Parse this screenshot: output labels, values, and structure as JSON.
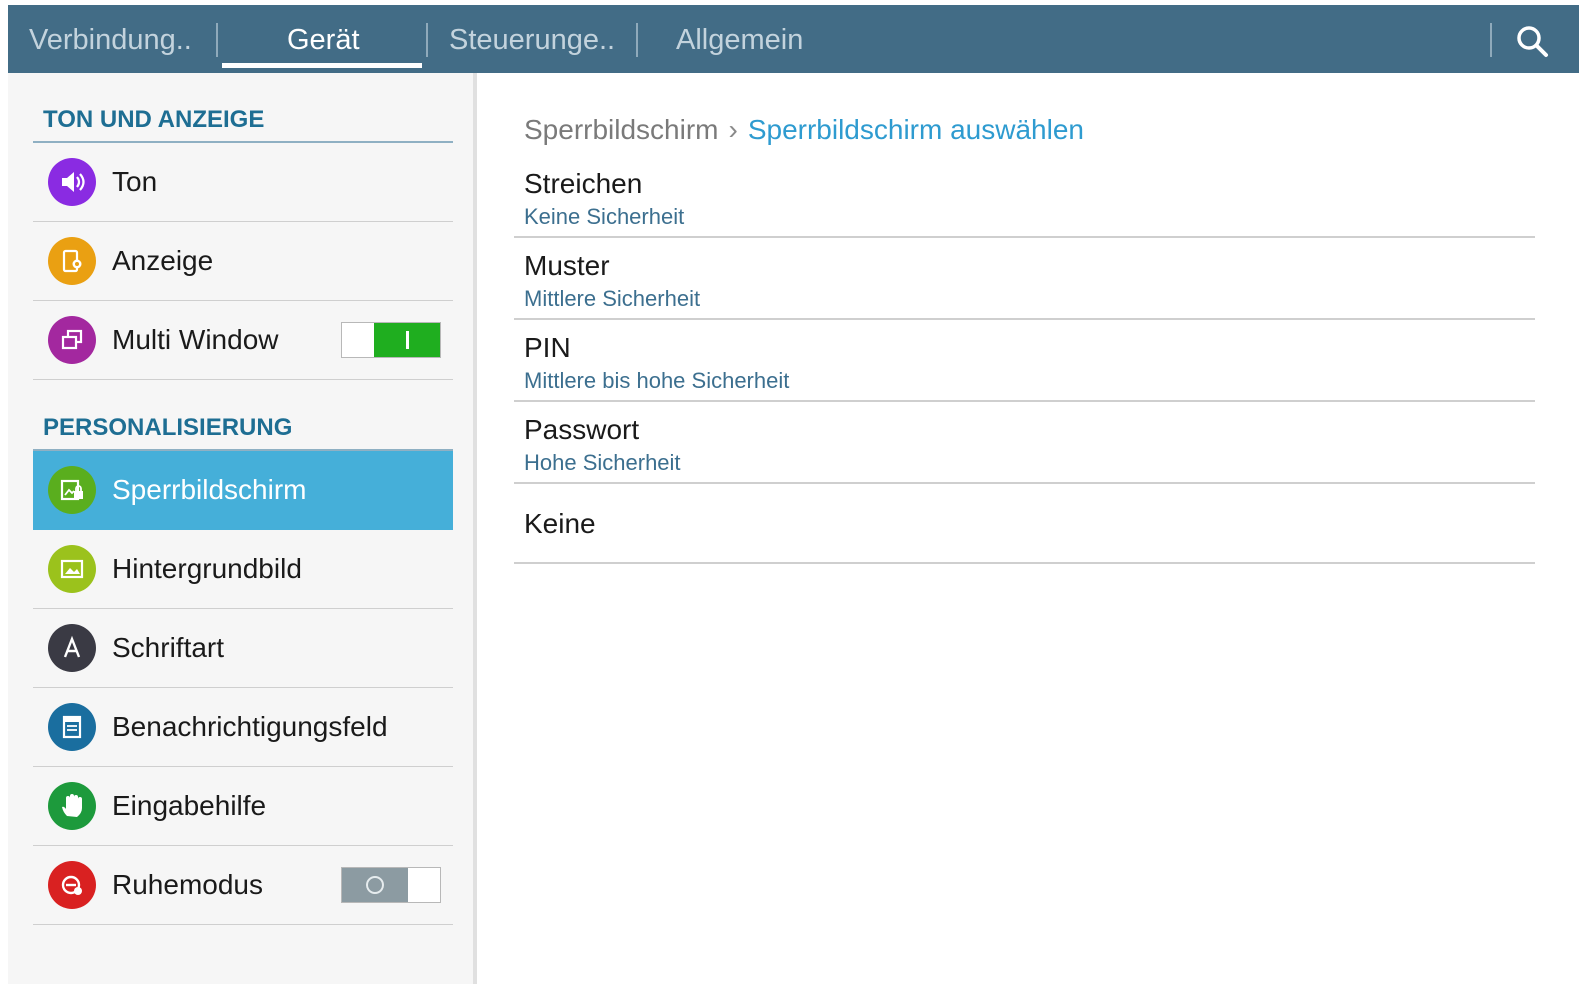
{
  "tabs": [
    {
      "label": "Verbindung.."
    },
    {
      "label": "Gerät"
    },
    {
      "label": "Steuerunge.."
    },
    {
      "label": "Allgemein"
    }
  ],
  "active_tab": "Gerät",
  "sidebar": {
    "sections": [
      {
        "header": "TON UND ANZEIGE",
        "items": [
          {
            "label": "Ton",
            "icon": "volume-icon",
            "color": "#8a2be2"
          },
          {
            "label": "Anzeige",
            "icon": "display-icon",
            "color": "#eaa012"
          },
          {
            "label": "Multi Window",
            "icon": "multi-window-icon",
            "color": "#a3289f",
            "toggle": "on"
          }
        ]
      },
      {
        "header": "PERSONALISIERUNG",
        "items": [
          {
            "label": "Sperrbildschirm",
            "icon": "lock-screen-icon",
            "color": "#5aae1e",
            "selected": true
          },
          {
            "label": "Hintergrundbild",
            "icon": "wallpaper-icon",
            "color": "#9bc21c"
          },
          {
            "label": "Schriftart",
            "icon": "font-icon",
            "color": "#3a3a44"
          },
          {
            "label": "Benachrichtigungsfeld",
            "icon": "notification-panel-icon",
            "color": "#1a6e9f"
          },
          {
            "label": "Eingabehilfe",
            "icon": "hand-icon",
            "color": "#1d9a3c"
          },
          {
            "label": "Ruhemodus",
            "icon": "blocking-mode-icon",
            "color": "#d92121",
            "toggle": "off"
          }
        ]
      }
    ]
  },
  "breadcrumb": {
    "parent": "Sperrbildschirm",
    "separator": "›",
    "current": "Sperrbildschirm auswählen"
  },
  "options": [
    {
      "title": "Streichen",
      "subtitle": "Keine Sicherheit"
    },
    {
      "title": "Muster",
      "subtitle": "Mittlere Sicherheit"
    },
    {
      "title": "PIN",
      "subtitle": "Mittlere bis hohe Sicherheit"
    },
    {
      "title": "Passwort",
      "subtitle": "Hohe Sicherheit"
    },
    {
      "title": "Keine",
      "subtitle": ""
    }
  ],
  "colors": {
    "topbar": "#426c86",
    "accent": "#45afd9",
    "section_header": "#1e6e93",
    "toggle_on": "#1fae1f"
  }
}
